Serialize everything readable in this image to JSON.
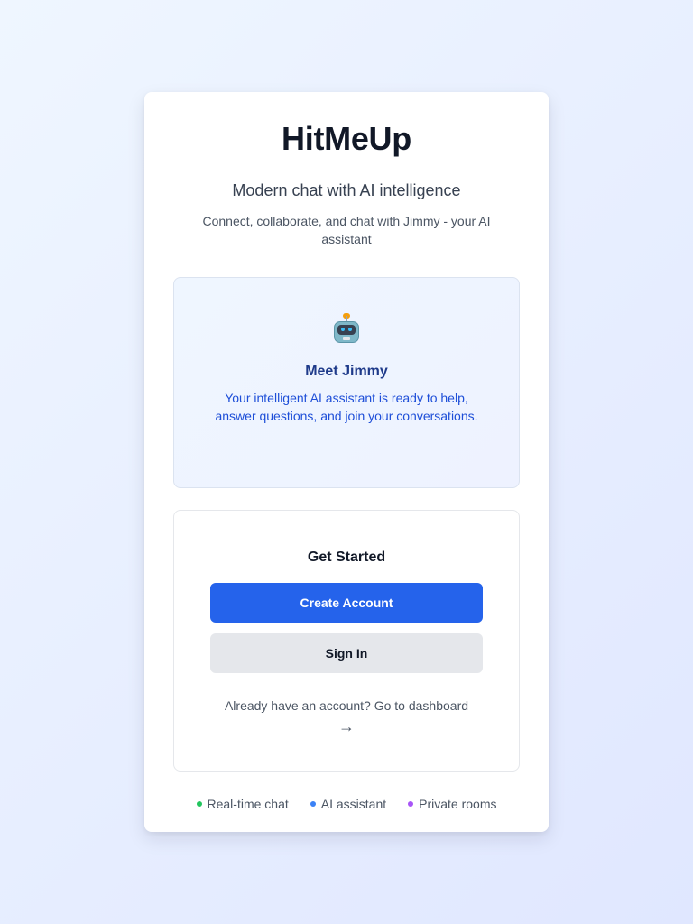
{
  "app": {
    "title": "HitMeUp",
    "tagline": "Modern chat with AI intelligence",
    "subtext": "Connect, collaborate, and chat with Jimmy - your AI assistant"
  },
  "jimmy": {
    "icon": "robot-icon",
    "title": "Meet Jimmy",
    "description": "Your intelligent AI assistant is ready to help, answer questions, and join your conversations."
  },
  "get_started": {
    "title": "Get Started",
    "create_account_label": "Create Account",
    "sign_in_label": "Sign In",
    "dashboard_link_text": "Already have an account? Go to dashboard",
    "dashboard_link_arrow": "→"
  },
  "features": [
    {
      "label": "Real-time chat",
      "color": "#22c55e"
    },
    {
      "label": "AI assistant",
      "color": "#3b82f6"
    },
    {
      "label": "Private rooms",
      "color": "#a855f7"
    }
  ],
  "colors": {
    "primary": "#2563eb",
    "secondary_button": "#e5e7eb",
    "jimmy_title": "#1e3a8a",
    "jimmy_text": "#1d4ed8"
  }
}
